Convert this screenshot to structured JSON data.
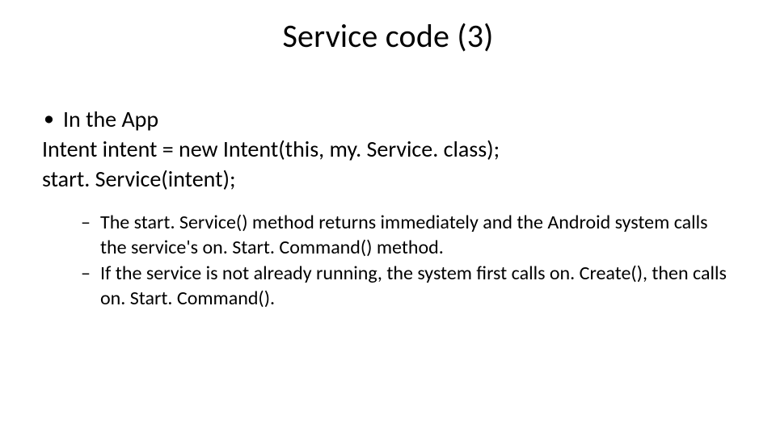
{
  "title": "Service code (3)",
  "body": {
    "l1_bullet_char": "•",
    "line1": "In the App",
    "line2": "Intent intent = new Intent(this, my. Service. class);",
    "line3": "start. Service(intent);",
    "l2_dash_char": "–",
    "sub1": "The start. Service() method returns immediately and the Android system calls the service's on. Start. Command() method.",
    "sub2": "If the service is not already running, the system first calls on. Create(), then calls on. Start. Command()."
  }
}
